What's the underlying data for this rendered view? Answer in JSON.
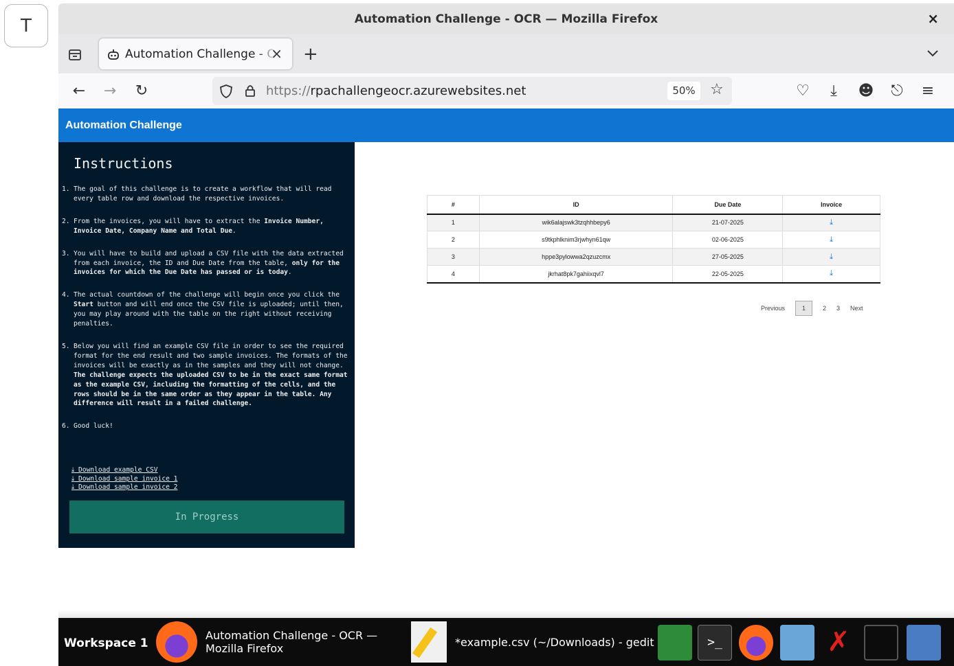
{
  "outer": {
    "letter": "T"
  },
  "window": {
    "title": "Automation Challenge - OCR — Mozilla Firefox",
    "close": "×"
  },
  "tab": {
    "label": "Automation Challenge - OCR",
    "close": "×",
    "new_tab": "+"
  },
  "nav": {
    "url_proto": "https://",
    "url_host": "rpachallengeocr.azurewebsites.net",
    "zoom": "50%"
  },
  "app": {
    "brand": "Automation Challenge",
    "instructions": {
      "heading": "Instructions",
      "items": [
        {
          "num": "1.",
          "text": "The goal of this challenge is to create a workflow that will read every table row and download the respective invoices."
        },
        {
          "num": "2.",
          "pre": "From the invoices, you will have to extract the ",
          "bold": "Invoice Number, Invoice Date, Company Name and Total Due",
          "post": "."
        },
        {
          "num": "3.",
          "pre": "You will have to build and upload a CSV file with the data extracted from each invoice, the ID and Due Date from the table, ",
          "bold": "only for the invoices for which the Due Date has passed or is today",
          "post": "."
        },
        {
          "num": "4.",
          "pre": "The actual countdown of the challenge will begin once you click the ",
          "bold": "Start",
          "post": " button and will end once the CSV file is uploaded; until then, you may play around with the table on the right without receiving penalties."
        },
        {
          "num": "5.",
          "pre": "Below you will find an example CSV file in order to see the required format for the end result and two sample invoices. The formats of the invoices will be exactly as in the samples and they will not change. ",
          "bold": "The challenge expects the uploaded CSV to be in the exact same format as the example CSV, including the formatting of the cells, and the rows should be in the same order as they appear in the table. Any difference will result in a failed challenge.",
          "post": ""
        },
        {
          "num": "6.",
          "text": "Good luck!"
        }
      ],
      "links": [
        " Download example CSV",
        " Download sample invoice 1",
        " Download sample invoice 2"
      ],
      "button": "In Progress"
    },
    "table": {
      "headers": [
        "#",
        "ID",
        "Due Date",
        "Invoice"
      ],
      "rows": [
        {
          "n": "1",
          "id": "wik6alajswk3tzqhhbepy6",
          "due": "21-07-2025"
        },
        {
          "n": "2",
          "id": "s9tkphlknim3rjwhyn61qw",
          "due": "02-06-2025"
        },
        {
          "n": "3",
          "id": "hppe3pylowwa2qzuzcmx",
          "due": "27-05-2025"
        },
        {
          "n": "4",
          "id": "jkrhat8pk7gahiixqvl7",
          "due": "22-05-2025"
        }
      ]
    },
    "pager": {
      "previous": "Previous",
      "pages": [
        "1",
        "2",
        "3"
      ],
      "next": "Next"
    }
  },
  "taskbar": {
    "workspace": "Workspace 1",
    "firefox_task_line1": "Automation Challenge - OCR —",
    "firefox_task_line2": "Mozilla Firefox",
    "gedit_task": "*example.csv (~/Downloads) - gedit"
  }
}
